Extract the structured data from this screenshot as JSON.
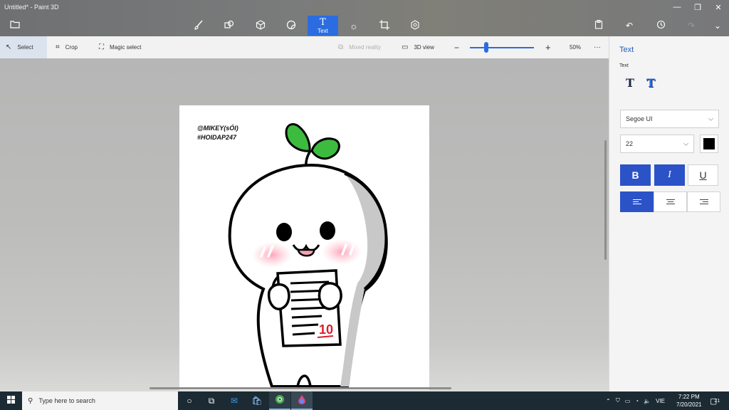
{
  "window": {
    "title": "Untitled* - Paint 3D"
  },
  "main_tools": [
    {
      "name": "brushes",
      "icon": "brush-icon"
    },
    {
      "name": "2d-shapes",
      "icon": "shapes-icon"
    },
    {
      "name": "3d-shapes",
      "icon": "cube-icon"
    },
    {
      "name": "stickers",
      "icon": "sticker-icon"
    },
    {
      "name": "text",
      "icon": "text-icon",
      "label": "Text",
      "active": true
    },
    {
      "name": "effects",
      "icon": "sun-icon"
    },
    {
      "name": "canvas",
      "icon": "crop-canvas-icon"
    },
    {
      "name": "3d-library",
      "icon": "library-icon"
    }
  ],
  "toolbar": {
    "select": "Select",
    "crop": "Crop",
    "magic_select": "Magic select",
    "mixed_reality": "Mixed reality",
    "view_3d": "3D view",
    "zoom": "50%",
    "zoom_fraction": 0.25,
    "more": "···"
  },
  "canvas": {
    "caption_line1": "@MIKEY(sÓI)",
    "caption_line2": "#HOIDAP247",
    "paper_score": "10"
  },
  "panel": {
    "title": "Text",
    "subtitle": "Text",
    "font": "Segoe UI",
    "size": "22",
    "color": "#000000",
    "bold": "B",
    "italic": "I",
    "underline": "U"
  },
  "taskbar": {
    "search_placeholder": "Type here to search",
    "language": "VIE",
    "time": "7:22 PM",
    "date": "7/20/2021",
    "notifications": "21"
  },
  "colors": {
    "accent": "#2b6de0",
    "panel_accent": "#1e5bb8",
    "taskbar": "#1b2a33"
  }
}
